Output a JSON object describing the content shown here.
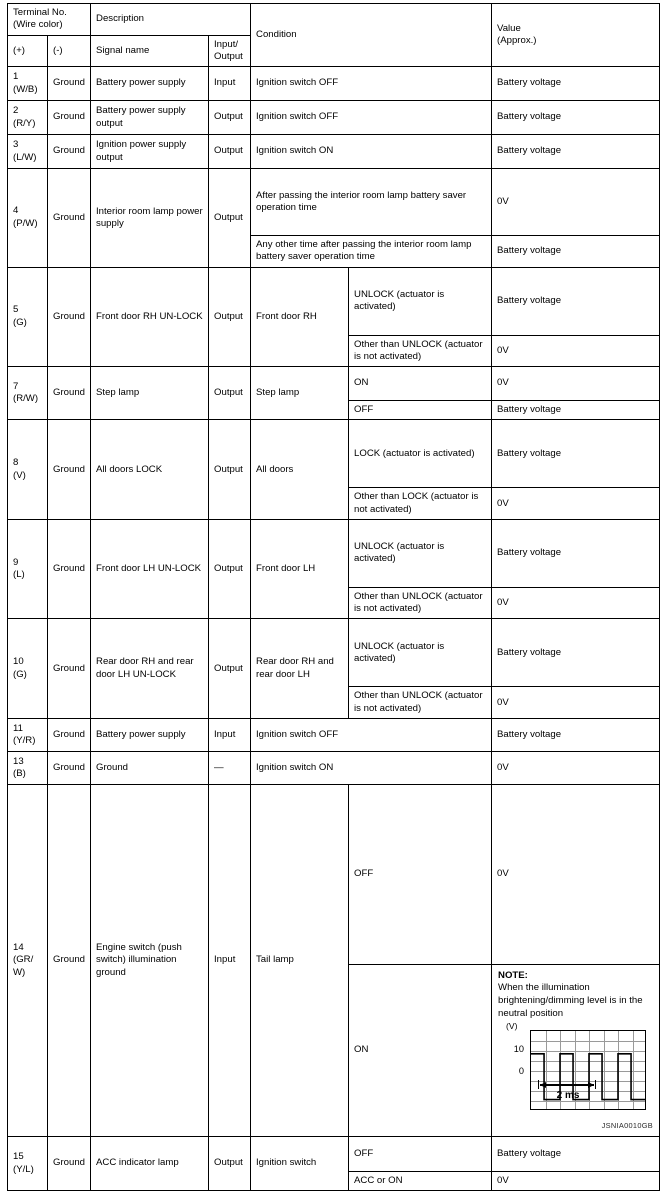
{
  "table": {
    "headers": {
      "terminal_group": "Terminal No.",
      "terminal_group_sub": "(Wire color)",
      "plus": "(+)",
      "minus": "(-)",
      "description": "Description",
      "signal_name": "Signal name",
      "input_output_l1": "Input/",
      "input_output_l2": "Output",
      "condition": "Condition",
      "value_l1": "Value",
      "value_l2": "(Approx.)"
    },
    "rows": [
      {
        "terminal_no": "1",
        "wire_color": "(W/B)",
        "minus": "Ground",
        "signal_name": "Battery power supply",
        "io": "Input",
        "conditions": [
          {
            "cond": "Ignition switch OFF",
            "value": "Battery voltage"
          }
        ]
      },
      {
        "terminal_no": "2",
        "wire_color": "(R/Y)",
        "minus": "Ground",
        "signal_name": "Battery power supply output",
        "io": "Output",
        "conditions": [
          {
            "cond": "Ignition switch OFF",
            "value": "Battery voltage"
          }
        ]
      },
      {
        "terminal_no": "3",
        "wire_color": "(L/W)",
        "minus": "Ground",
        "signal_name": "Ignition power supply output",
        "io": "Output",
        "conditions": [
          {
            "cond": "Ignition switch ON",
            "value": "Battery voltage"
          }
        ]
      },
      {
        "terminal_no": "4",
        "wire_color": "(P/W)",
        "minus": "Ground",
        "signal_name": "Interior room lamp power supply",
        "io": "Output",
        "conditions": [
          {
            "cond": "After passing the interior room lamp battery saver operation time",
            "value": "0V"
          },
          {
            "cond": "Any other time after passing the interior room lamp battery saver operation time",
            "value": "Battery voltage"
          }
        ]
      },
      {
        "terminal_no": "5",
        "wire_color": "(G)",
        "minus": "Ground",
        "signal_name": "Front door RH UN-LOCK",
        "io": "Output",
        "cond_main": "Front door RH",
        "conditions": [
          {
            "cond": "UNLOCK (actuator is activated)",
            "value": "Battery voltage"
          },
          {
            "cond": "Other than UNLOCK (actuator is not activated)",
            "value": "0V"
          }
        ]
      },
      {
        "terminal_no": "7",
        "wire_color": "(R/W)",
        "minus": "Ground",
        "signal_name": "Step lamp",
        "io": "Output",
        "cond_main": "Step lamp",
        "conditions": [
          {
            "cond": "ON",
            "value": "0V"
          },
          {
            "cond": "OFF",
            "value": "Battery voltage"
          }
        ]
      },
      {
        "terminal_no": "8",
        "wire_color": "(V)",
        "minus": "Ground",
        "signal_name": "All doors LOCK",
        "io": "Output",
        "cond_main": "All doors",
        "conditions": [
          {
            "cond": "LOCK (actuator is activated)",
            "value": "Battery voltage"
          },
          {
            "cond": "Other than LOCK (actuator is not activated)",
            "value": "0V"
          }
        ]
      },
      {
        "terminal_no": "9",
        "wire_color": "(L)",
        "minus": "Ground",
        "signal_name": "Front door LH UN-LOCK",
        "io": "Output",
        "cond_main": "Front door LH",
        "conditions": [
          {
            "cond": "UNLOCK (actuator is activated)",
            "value": "Battery voltage"
          },
          {
            "cond": "Other than UNLOCK (actuator is not activated)",
            "value": "0V"
          }
        ]
      },
      {
        "terminal_no": "10",
        "wire_color": "(G)",
        "minus": "Ground",
        "signal_name": "Rear door RH and rear door LH UN-LOCK",
        "io": "Output",
        "cond_main": "Rear door RH and rear door LH",
        "conditions": [
          {
            "cond": "UNLOCK (actuator is activated)",
            "value": "Battery voltage"
          },
          {
            "cond": "Other than UNLOCK (actuator is not activated)",
            "value": "0V"
          }
        ]
      },
      {
        "terminal_no": "11",
        "wire_color": "(Y/R)",
        "minus": "Ground",
        "signal_name": "Battery power supply",
        "io": "Input",
        "conditions": [
          {
            "cond": "Ignition switch OFF",
            "value": "Battery voltage"
          }
        ]
      },
      {
        "terminal_no": "13",
        "wire_color": "(B)",
        "minus": "Ground",
        "signal_name": "Ground",
        "io": "—",
        "conditions": [
          {
            "cond": "Ignition switch ON",
            "value": "0V"
          }
        ]
      },
      {
        "terminal_no": "14",
        "wire_color": "(GR/ W)",
        "minus": "Ground",
        "signal_name": "Engine switch (push switch) illumination ground",
        "io": "Input",
        "cond_main": "Tail lamp",
        "conditions": [
          {
            "cond": "OFF",
            "value": "0V"
          },
          {
            "cond": "ON",
            "value": ""
          }
        ]
      },
      {
        "terminal_no": "15",
        "wire_color": "(Y/L)",
        "minus": "Ground",
        "signal_name": "ACC indicator lamp",
        "io": "Output",
        "cond_main": "Ignition switch",
        "conditions": [
          {
            "cond": "OFF",
            "value": "Battery voltage"
          },
          {
            "cond": "ACC or ON",
            "value": "0V"
          }
        ]
      }
    ]
  },
  "note": {
    "title": "NOTE:",
    "body": "When the illumination brightening/dimming level is in the neutral position",
    "image_id": "JSNIA0010GB"
  },
  "chart_data": {
    "type": "line",
    "title": "",
    "xlabel": "",
    "ylabel": "(V)",
    "unit_label": "(V)",
    "y_ticks": [
      10,
      0
    ],
    "ylim": [
      -2.5,
      15
    ],
    "x_span_label": "2 ms",
    "grid": true,
    "description": "Square wave pulse train, approximately 50% duty cycle",
    "x": [
      0,
      0.45,
      0.45,
      1.0,
      1.0,
      1.45,
      1.45,
      2.0,
      2.0,
      2.45,
      2.45,
      3.0,
      3.0,
      3.45,
      3.45,
      4.0,
      4.0
    ],
    "values": [
      10,
      10,
      0,
      0,
      10,
      10,
      0,
      0,
      10,
      10,
      0,
      0,
      10,
      10,
      0,
      0,
      10
    ],
    "high_level": 10,
    "low_level": 0,
    "period_ms": 2,
    "cycles": 4
  }
}
